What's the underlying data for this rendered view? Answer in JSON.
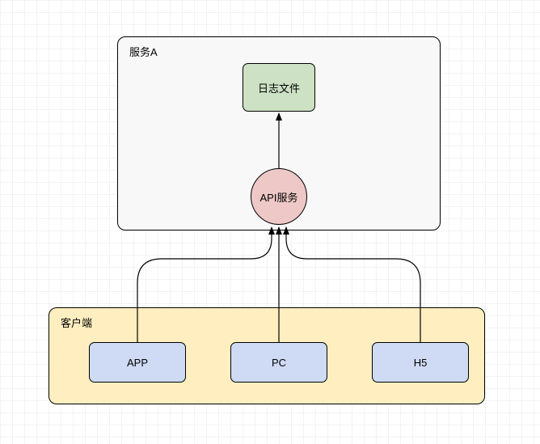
{
  "serviceA": {
    "title": "服务A",
    "logFileLabel": "日志文件",
    "apiServiceLabel": "API服务"
  },
  "clients": {
    "title": "客户端",
    "items": [
      {
        "label": "APP"
      },
      {
        "label": "PC"
      },
      {
        "label": "H5"
      }
    ]
  }
}
